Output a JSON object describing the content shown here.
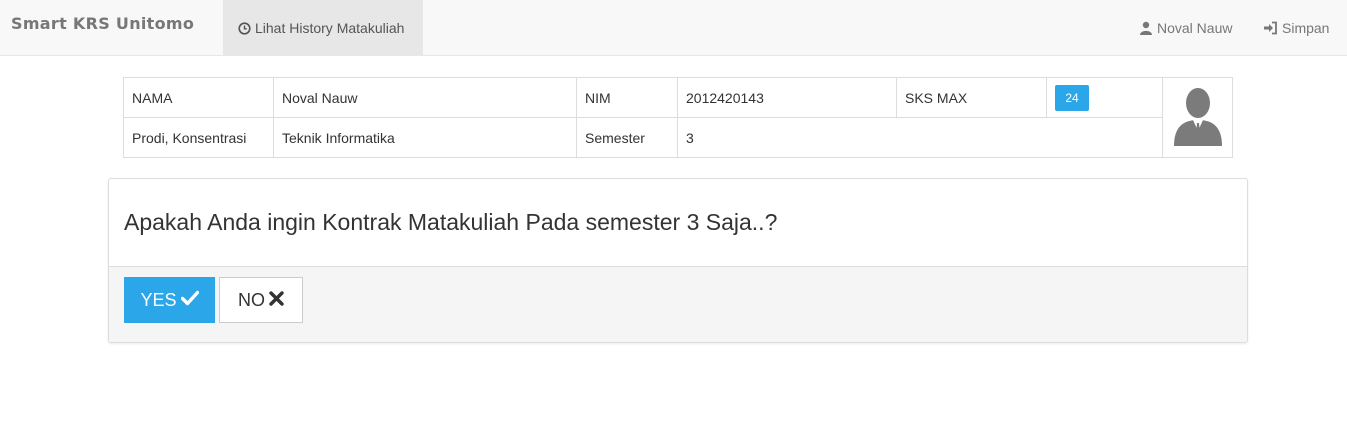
{
  "navbar": {
    "brand": "Smart KRS Unitomo",
    "history_label": "Lihat History Matakuliah",
    "user_label": "Noval Nauw",
    "save_label": "Simpan"
  },
  "student": {
    "nama_label": "NAMA",
    "nama_value": "Noval Nauw",
    "nim_label": "NIM",
    "nim_value": "2012420143",
    "sks_label": "SKS MAX",
    "sks_value": "24",
    "prodi_label": "Prodi, Konsentrasi",
    "prodi_value": "Teknik Informatika",
    "semester_label": "Semester",
    "semester_value": "3"
  },
  "dialog": {
    "question": "Apakah Anda ingin Kontrak Matakuliah Pada semester 3 Saja..?",
    "yes_label": "YES",
    "no_label": "NO"
  },
  "colors": {
    "accent": "#2ba6e8",
    "navbar_bg": "#f8f8f8",
    "footer_bg": "#f5f5f5"
  },
  "icons": [
    "clock-icon",
    "user-icon",
    "sign-in-icon",
    "check-icon",
    "times-icon",
    "avatar-silhouette-icon"
  ]
}
